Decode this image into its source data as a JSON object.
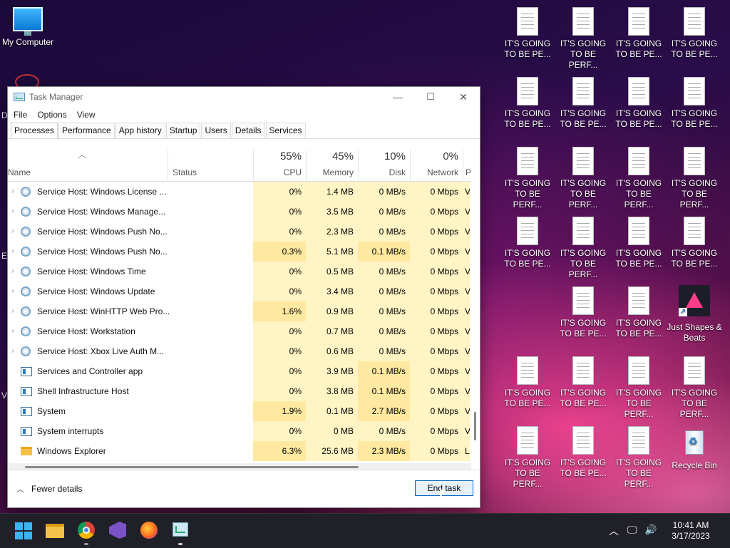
{
  "desktop": {
    "my_computer": "My Computer",
    "left_partial_1": "D",
    "left_partial_2": "E",
    "left_partial_3": "V",
    "docs": [
      {
        "label": "IT'S GOING TO BE PE..."
      },
      {
        "label": "IT'S GOING TO BE PERF..."
      },
      {
        "label": "IT'S GOING TO BE PE..."
      },
      {
        "label": "IT'S GOING TO BE PE..."
      },
      {
        "label": "IT'S GOING TO BE PE..."
      },
      {
        "label": "IT'S GOING TO BE PE..."
      },
      {
        "label": "IT'S GOING TO BE PE..."
      },
      {
        "label": "IT'S GOING TO BE PE..."
      },
      {
        "label": "IT'S GOING TO BE PERF..."
      },
      {
        "label": "IT'S GOING TO BE PERF..."
      },
      {
        "label": "IT'S GOING TO BE PERF..."
      },
      {
        "label": "IT'S GOING TO BE PERF..."
      },
      {
        "label": "IT'S GOING TO BE PE..."
      },
      {
        "label": "IT'S GOING TO BE PERF..."
      },
      {
        "label": "IT'S GOING TO BE PE..."
      },
      {
        "label": "IT'S GOING TO BE PE..."
      },
      {
        "label": "IT'S GOING TO BE PE..."
      },
      {
        "label": "IT'S GOING TO BE PE..."
      },
      {
        "label": "IT'S GOING TO BE PE..."
      },
      {
        "label": "IT'S GOING TO BE PE..."
      },
      {
        "label": "IT'S GOING TO BE PERF..."
      },
      {
        "label": "IT'S GOING TO BE PERF..."
      },
      {
        "label": "IT'S GOING TO BE PERF..."
      },
      {
        "label": "IT'S GOING TO BE PE..."
      },
      {
        "label": "IT'S GOING TO BE PERF..."
      }
    ],
    "just_shapes": "Just Shapes & Beats",
    "recycle_bin": "Recycle Bin"
  },
  "window": {
    "title": "Task Manager",
    "minimize": "—",
    "maximize": "☐",
    "close": "✕",
    "menu": [
      "File",
      "Options",
      "View"
    ],
    "tabs": [
      "Processes",
      "Performance",
      "App history",
      "Startup",
      "Users",
      "Details",
      "Services"
    ],
    "columns": {
      "name": "Name",
      "status": "Status",
      "cpu_pct": "55%",
      "cpu": "CPU",
      "mem_pct": "45%",
      "mem": "Memory",
      "disk_pct": "10%",
      "disk": "Disk",
      "net_pct": "0%",
      "net": "Network",
      "power": "Pow"
    },
    "rows": [
      {
        "name": "Service Host: Windows License ...",
        "cpu": "0%",
        "mem": "1.4 MB",
        "disk": "0 MB/s",
        "net": "0 Mbps",
        "pow": "V",
        "icon": "gear",
        "expand": "›"
      },
      {
        "name": "Service Host: Windows Manage...",
        "cpu": "0%",
        "mem": "3.5 MB",
        "disk": "0 MB/s",
        "net": "0 Mbps",
        "pow": "V",
        "icon": "gear",
        "expand": "›"
      },
      {
        "name": "Service Host: Windows Push No...",
        "cpu": "0%",
        "mem": "2.3 MB",
        "disk": "0 MB/s",
        "net": "0 Mbps",
        "pow": "V",
        "icon": "gear",
        "expand": "›"
      },
      {
        "name": "Service Host: Windows Push No...",
        "cpu": "0.3%",
        "mem": "5.1 MB",
        "disk": "0.1 MB/s",
        "net": "0 Mbps",
        "pow": "V",
        "icon": "gear",
        "expand": "›"
      },
      {
        "name": "Service Host: Windows Time",
        "cpu": "0%",
        "mem": "0.5 MB",
        "disk": "0 MB/s",
        "net": "0 Mbps",
        "pow": "V",
        "icon": "gear",
        "expand": "›"
      },
      {
        "name": "Service Host: Windows Update",
        "cpu": "0%",
        "mem": "3.4 MB",
        "disk": "0 MB/s",
        "net": "0 Mbps",
        "pow": "V",
        "icon": "gear",
        "expand": "›"
      },
      {
        "name": "Service Host: WinHTTP Web Pro...",
        "cpu": "1.6%",
        "mem": "0.9 MB",
        "disk": "0 MB/s",
        "net": "0 Mbps",
        "pow": "V",
        "icon": "gear",
        "expand": "›"
      },
      {
        "name": "Service Host: Workstation",
        "cpu": "0%",
        "mem": "0.7 MB",
        "disk": "0 MB/s",
        "net": "0 Mbps",
        "pow": "V",
        "icon": "gear",
        "expand": "›"
      },
      {
        "name": "Service Host: Xbox Live Auth M...",
        "cpu": "0%",
        "mem": "0.6 MB",
        "disk": "0 MB/s",
        "net": "0 Mbps",
        "pow": "V",
        "icon": "gear",
        "expand": "›"
      },
      {
        "name": "Services and Controller app",
        "cpu": "0%",
        "mem": "3.9 MB",
        "disk": "0.1 MB/s",
        "net": "0 Mbps",
        "pow": "V",
        "icon": "app",
        "expand": ""
      },
      {
        "name": "Shell Infrastructure Host",
        "cpu": "0%",
        "mem": "3.8 MB",
        "disk": "0.1 MB/s",
        "net": "0 Mbps",
        "pow": "V",
        "icon": "app",
        "expand": ""
      },
      {
        "name": "System",
        "cpu": "1.9%",
        "mem": "0.1 MB",
        "disk": "2.7 MB/s",
        "net": "0 Mbps",
        "pow": "V",
        "icon": "app",
        "expand": ""
      },
      {
        "name": "System interrupts",
        "cpu": "0%",
        "mem": "0 MB",
        "disk": "0 MB/s",
        "net": "0 Mbps",
        "pow": "V",
        "icon": "app",
        "expand": ""
      },
      {
        "name": "Windows Explorer",
        "cpu": "6.3%",
        "mem": "25.6 MB",
        "disk": "2.3 MB/s",
        "net": "0 Mbps",
        "pow": "L",
        "icon": "folder",
        "expand": ""
      }
    ],
    "fewer_details": "Fewer details",
    "end_task": "End task"
  },
  "taskbar": {
    "time": "10:41 AM",
    "date": "3/17/2023"
  }
}
